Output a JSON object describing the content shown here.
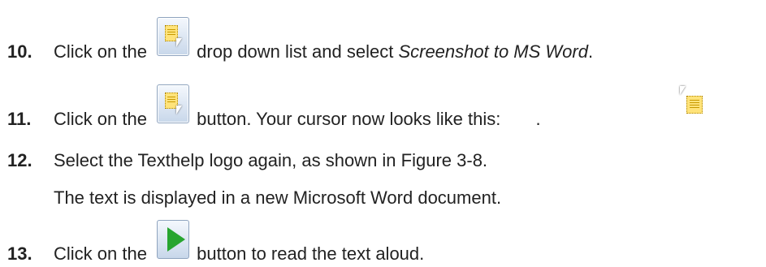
{
  "steps": [
    {
      "number": "10.",
      "before": "Click on the ",
      "after": " drop down list and select ",
      "italic": "Screenshot to MS Word",
      "end": ".",
      "icon": "screenshot-reader-icon"
    },
    {
      "number": "11.",
      "before": "Click on the ",
      "after": " button. Your cursor now looks like this: ",
      "end": ".",
      "icon": "screenshot-reader-icon",
      "cursor_icon": "screenshot-cursor-icon"
    },
    {
      "number": "12.",
      "text": "Select the Texthelp logo again, as shown in Figure 3-8.",
      "note": "The text is displayed in a new Microsoft Word document."
    },
    {
      "number": "13.",
      "before": "Click on the ",
      "after": " button to read the text aloud.",
      "icon": "play-icon"
    }
  ],
  "colors": {
    "text": "#222222",
    "icon_note": "#ffe37a",
    "play": "#27a52f"
  }
}
